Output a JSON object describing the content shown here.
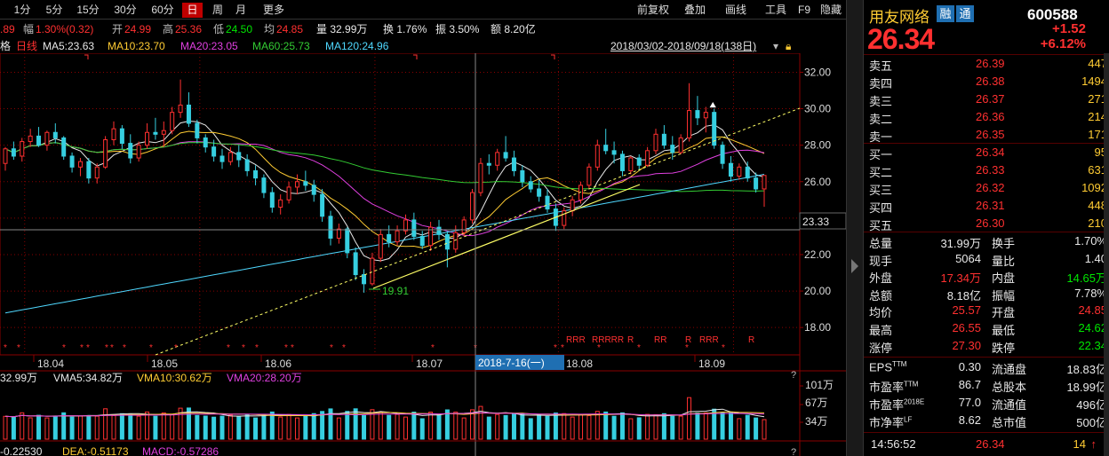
{
  "toolbar": {
    "periods": [
      "1分",
      "5分",
      "15分",
      "30分",
      "60分",
      "日",
      "周",
      "月",
      "更多"
    ],
    "active_period": "日",
    "right": [
      "前复权",
      "叠加",
      "画线",
      "工具",
      "F9",
      "隐藏"
    ]
  },
  "info": {
    "price_partial": ".89",
    "change_label": "幅",
    "change": "1.30%(0.32)",
    "open_label": "开",
    "open": "24.99",
    "high_label": "高",
    "high": "25.36",
    "low_label": "低",
    "low": "24.50",
    "avg_label": "均",
    "avg": "24.85",
    "volume": "量 32.99万",
    "turnover": "换 1.76%",
    "amplitude": "振 3.50%",
    "amount": "额 8.20亿"
  },
  "ma_legend": {
    "prefix": "格",
    "period_tag": "日线",
    "ma5": "MA5:23.63",
    "ma10": "MA10:23.70",
    "ma20": "MA20:23.05",
    "ma60": "MA60:25.73",
    "ma120": "MA120:24.96",
    "date_range": "2018/03/02-2018/09/18(138日)"
  },
  "colors": {
    "up": "#ff3030",
    "down": "#36cfe0",
    "ma5": "#e8e8e8",
    "ma10": "#ffcc33",
    "ma20": "#e040e0",
    "ma60": "#33cc33",
    "ma120": "#4fd8ff",
    "grid": "#8a0000"
  },
  "main_axis": {
    "ticks": [
      "32.00",
      "30.00",
      "28.00",
      "26.00",
      "24.00",
      "22.00",
      "20.00",
      "18.00"
    ],
    "cursor_price": "23.33",
    "min_label": "19.91",
    "x_labels": [
      "18.04",
      "18.05",
      "18.06",
      "18.07",
      "18.08",
      "18.09"
    ],
    "cursor_date": "2018-7-16(一)"
  },
  "vol_panel": {
    "legend": {
      "vol": "32.99万",
      "vma5": "VMA5:34.82万",
      "vma10": "VMA10:30.62万",
      "vma20": "VMA20:28.20万"
    },
    "ticks": [
      "101万",
      "67万",
      "34万"
    ],
    "help": "?"
  },
  "macd_legend": {
    "dif": "-0.22530",
    "dea": "DEA:-0.51173",
    "macd": "MACD:-0.57286"
  },
  "quote": {
    "name": "用友网络",
    "tag1": "融",
    "tag2": "通",
    "code": "600588",
    "price": "26.34",
    "change": "+1.52",
    "change_pct": "+6.12%",
    "asks": [
      {
        "label": "卖五",
        "price": "26.39",
        "vol": "447"
      },
      {
        "label": "卖四",
        "price": "26.38",
        "vol": "1494"
      },
      {
        "label": "卖三",
        "price": "26.37",
        "vol": "271"
      },
      {
        "label": "卖二",
        "price": "26.36",
        "vol": "214"
      },
      {
        "label": "卖一",
        "price": "26.35",
        "vol": "171"
      }
    ],
    "bids": [
      {
        "label": "买一",
        "price": "26.34",
        "vol": "95"
      },
      {
        "label": "买二",
        "price": "26.33",
        "vol": "631"
      },
      {
        "label": "买三",
        "price": "26.32",
        "vol": "1092"
      },
      {
        "label": "买四",
        "price": "26.31",
        "vol": "448"
      },
      {
        "label": "买五",
        "price": "26.30",
        "vol": "210"
      }
    ],
    "stats": [
      {
        "l1": "总量",
        "v1": "31.99万",
        "c1": "wht",
        "l2": "换手",
        "v2": "1.70%",
        "c2": "wht"
      },
      {
        "l1": "现手",
        "v1": "5064",
        "c1": "wht",
        "l2": "量比",
        "v2": "1.40",
        "c2": "wht"
      },
      {
        "l1": "外盘",
        "v1": "17.34万",
        "c1": "red",
        "l2": "内盘",
        "v2": "14.65万",
        "c2": "grn"
      },
      {
        "l1": "总额",
        "v1": "8.18亿",
        "c1": "wht",
        "l2": "振幅",
        "v2": "7.78%",
        "c2": "wht"
      },
      {
        "l1": "均价",
        "v1": "25.57",
        "c1": "red",
        "l2": "开盘",
        "v2": "24.85",
        "c2": "red"
      },
      {
        "l1": "最高",
        "v1": "26.55",
        "c1": "red",
        "l2": "最低",
        "v2": "24.62",
        "c2": "grn"
      },
      {
        "l1": "涨停",
        "v1": "27.30",
        "c1": "red",
        "l2": "跌停",
        "v2": "22.34",
        "c2": "grn"
      }
    ],
    "fund": [
      {
        "l1": "EPS",
        "s1": "TTM",
        "v1": "0.30",
        "l2": "流通盘",
        "v2": "18.83亿"
      },
      {
        "l1": "市盈率",
        "s1": "TTM",
        "v1": "86.7",
        "l2": "总股本",
        "v2": "18.99亿"
      },
      {
        "l1": "市盈率",
        "s1": "2018E",
        "v1": "77.0",
        "l2": "流通值",
        "v2": "496亿"
      },
      {
        "l1": "市净率",
        "s1": "LF",
        "v1": "8.62",
        "l2": "总市值",
        "v2": "500亿"
      }
    ],
    "tick": {
      "time": "14:56:52",
      "price": "26.34",
      "vol": "14"
    }
  },
  "chart_data": {
    "type": "candlestick",
    "period": "daily",
    "range": "2018/03/02-2018/09/18",
    "ylim": [
      16.5,
      32.8
    ],
    "y_ticks": [
      18,
      20,
      22,
      24,
      26,
      28,
      30,
      32
    ],
    "x_labels": [
      "18.04",
      "18.05",
      "18.06",
      "18.07",
      "18.08",
      "18.09"
    ],
    "candles": [
      [
        27.0,
        27.9,
        26.6,
        27.8
      ],
      [
        27.8,
        28.2,
        27.2,
        27.4
      ],
      [
        27.4,
        28.4,
        27.1,
        28.2
      ],
      [
        28.2,
        28.9,
        27.9,
        28.5
      ],
      [
        28.5,
        29.0,
        27.9,
        28.0
      ],
      [
        28.0,
        28.8,
        27.7,
        28.7
      ],
      [
        28.7,
        29.2,
        28.1,
        28.4
      ],
      [
        28.4,
        28.5,
        27.2,
        27.4
      ],
      [
        27.4,
        27.6,
        26.5,
        26.8
      ],
      [
        26.8,
        27.3,
        26.3,
        27.1
      ],
      [
        27.1,
        27.3,
        25.9,
        26.2
      ],
      [
        26.2,
        27.0,
        25.9,
        26.8
      ],
      [
        26.8,
        28.5,
        26.7,
        28.3
      ],
      [
        28.3,
        29.3,
        28.0,
        28.9
      ],
      [
        28.9,
        29.1,
        27.8,
        28.1
      ],
      [
        28.1,
        28.6,
        27.0,
        27.3
      ],
      [
        27.3,
        28.2,
        27.1,
        28.0
      ],
      [
        28.0,
        29.2,
        27.8,
        28.7
      ],
      [
        28.7,
        29.5,
        28.3,
        28.6
      ],
      [
        28.6,
        29.3,
        27.9,
        28.8
      ],
      [
        28.8,
        30.1,
        28.6,
        29.8
      ],
      [
        29.8,
        31.6,
        29.5,
        30.2
      ],
      [
        30.2,
        30.9,
        29.0,
        29.2
      ],
      [
        29.2,
        29.4,
        28.1,
        28.4
      ],
      [
        28.4,
        28.6,
        27.6,
        27.9
      ],
      [
        27.9,
        28.3,
        27.1,
        27.4
      ],
      [
        27.4,
        27.8,
        26.7,
        27.1
      ],
      [
        27.1,
        27.9,
        26.9,
        27.6
      ],
      [
        27.6,
        28.0,
        26.8,
        27.2
      ],
      [
        27.2,
        27.5,
        26.3,
        26.6
      ],
      [
        26.6,
        26.9,
        25.8,
        26.2
      ],
      [
        26.2,
        26.4,
        25.1,
        25.4
      ],
      [
        25.4,
        25.7,
        24.3,
        24.6
      ],
      [
        24.6,
        25.3,
        24.2,
        25.0
      ],
      [
        25.0,
        26.0,
        24.8,
        25.7
      ],
      [
        25.7,
        26.4,
        25.3,
        26.0
      ],
      [
        26.0,
        26.6,
        25.5,
        25.8
      ],
      [
        25.8,
        26.1,
        24.9,
        25.3
      ],
      [
        25.3,
        25.6,
        23.8,
        24.1
      ],
      [
        24.1,
        24.4,
        22.5,
        22.9
      ],
      [
        22.9,
        23.7,
        22.6,
        23.4
      ],
      [
        23.4,
        23.5,
        21.8,
        22.1
      ],
      [
        22.1,
        22.4,
        20.6,
        20.9
      ],
      [
        20.9,
        21.2,
        19.91,
        20.4
      ],
      [
        20.4,
        22.1,
        20.3,
        21.8
      ],
      [
        21.8,
        23.4,
        21.6,
        23.1
      ],
      [
        23.1,
        23.6,
        22.4,
        22.7
      ],
      [
        22.7,
        23.6,
        22.5,
        23.3
      ],
      [
        23.3,
        24.2,
        23.1,
        23.9
      ],
      [
        23.9,
        24.3,
        22.8,
        23.0
      ],
      [
        23.0,
        23.3,
        22.3,
        22.5
      ],
      [
        22.5,
        23.8,
        22.2,
        23.5
      ],
      [
        23.5,
        23.9,
        22.8,
        23.1
      ],
      [
        23.1,
        23.3,
        21.3,
        22.3
      ],
      [
        22.3,
        23.6,
        22.1,
        23.2
      ],
      [
        23.2,
        24.1,
        23.0,
        23.9
      ],
      [
        23.9,
        25.6,
        23.7,
        25.4
      ],
      [
        25.4,
        27.3,
        25.2,
        27.0
      ],
      [
        27.0,
        27.5,
        26.4,
        26.9
      ],
      [
        26.9,
        27.8,
        26.6,
        27.6
      ],
      [
        27.6,
        28.5,
        27.1,
        27.3
      ],
      [
        27.3,
        27.7,
        26.3,
        26.6
      ],
      [
        26.6,
        26.9,
        25.7,
        26.0
      ],
      [
        26.0,
        26.3,
        25.4,
        25.6
      ],
      [
        25.6,
        26.1,
        24.9,
        25.2
      ],
      [
        25.2,
        25.6,
        24.3,
        24.5
      ],
      [
        24.5,
        24.8,
        23.3,
        23.6
      ],
      [
        23.6,
        24.6,
        23.4,
        24.4
      ],
      [
        24.4,
        25.2,
        24.1,
        25.0
      ],
      [
        25.0,
        26.0,
        24.8,
        25.8
      ],
      [
        25.8,
        27.0,
        25.6,
        26.8
      ],
      [
        26.8,
        28.3,
        26.6,
        28.0
      ],
      [
        28.0,
        28.9,
        27.5,
        27.7
      ],
      [
        27.7,
        28.2,
        27.0,
        27.5
      ],
      [
        27.5,
        27.7,
        26.3,
        26.6
      ],
      [
        26.6,
        27.4,
        26.4,
        27.3
      ],
      [
        27.3,
        27.5,
        26.6,
        26.9
      ],
      [
        26.9,
        27.9,
        26.8,
        27.7
      ],
      [
        27.7,
        28.9,
        27.5,
        28.6
      ],
      [
        28.6,
        29.1,
        27.8,
        28.0
      ],
      [
        28.0,
        28.5,
        27.2,
        27.6
      ],
      [
        27.6,
        28.6,
        27.5,
        28.4
      ],
      [
        28.4,
        31.4,
        28.2,
        29.9
      ],
      [
        29.9,
        30.7,
        29.1,
        29.5
      ],
      [
        29.5,
        30.1,
        28.7,
        29.8
      ],
      [
        29.8,
        30.0,
        27.8,
        28.0
      ],
      [
        28.0,
        28.2,
        26.7,
        27.0
      ],
      [
        27.0,
        27.4,
        26.0,
        26.3
      ],
      [
        26.3,
        27.0,
        26.1,
        26.8
      ],
      [
        26.8,
        27.1,
        26.0,
        26.2
      ],
      [
        26.2,
        26.5,
        25.4,
        25.6
      ],
      [
        25.6,
        26.2,
        24.62,
        26.34
      ]
    ],
    "ma": {
      "MA5": 23.63,
      "MA10": 23.7,
      "MA20": 23.05,
      "MA60": 25.73,
      "MA120": 24.96
    },
    "annotations": [
      "19.91",
      "2018-7-16(一)"
    ]
  }
}
